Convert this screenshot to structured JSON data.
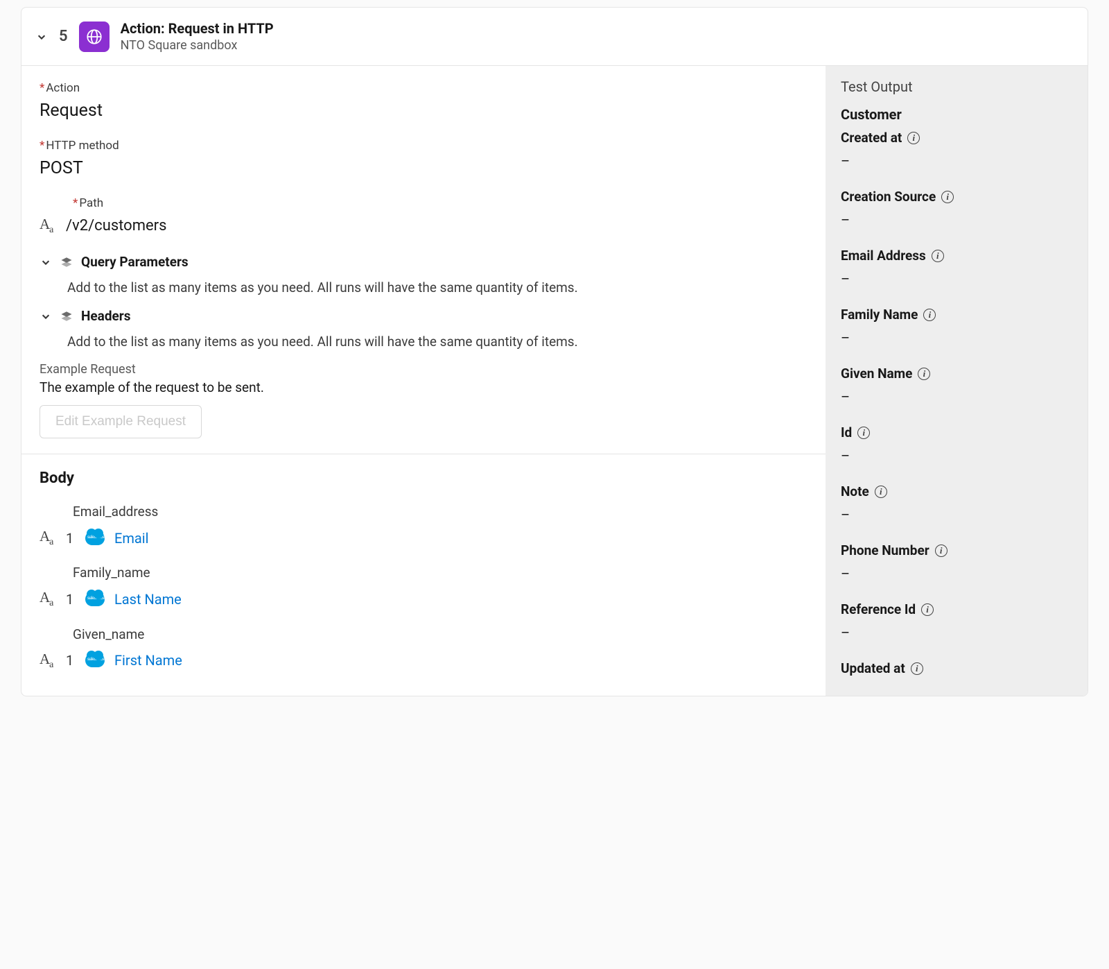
{
  "step": {
    "number": "5",
    "title": "Action: Request in HTTP",
    "subtitle": "NTO Square sandbox"
  },
  "form": {
    "action": {
      "label": "Action",
      "value": "Request"
    },
    "http_method": {
      "label": "HTTP method",
      "value": "POST"
    },
    "path": {
      "label": "Path",
      "value": "/v2/customers"
    },
    "query_params": {
      "title": "Query Parameters",
      "helper": "Add to the list as many items as you need. All runs will have the same quantity of items."
    },
    "headers": {
      "title": "Headers",
      "helper": "Add to the list as many items as you need. All runs will have the same quantity of items."
    },
    "example": {
      "label": "Example Request",
      "desc": "The example of the request to be sent.",
      "button": "Edit Example Request"
    }
  },
  "body": {
    "title": "Body",
    "fields": [
      {
        "label": "Email_address",
        "index": "1",
        "value": "Email"
      },
      {
        "label": "Family_name",
        "index": "1",
        "value": "Last Name"
      },
      {
        "label": "Given_name",
        "index": "1",
        "value": "First Name"
      }
    ]
  },
  "output": {
    "title": "Test Output",
    "section": "Customer",
    "fields": [
      {
        "label": "Created at",
        "value": "–"
      },
      {
        "label": "Creation Source",
        "value": "–"
      },
      {
        "label": "Email Address",
        "value": "–"
      },
      {
        "label": "Family Name",
        "value": "–"
      },
      {
        "label": "Given Name",
        "value": "–"
      },
      {
        "label": "Id",
        "value": "–"
      },
      {
        "label": "Note",
        "value": "–"
      },
      {
        "label": "Phone Number",
        "value": "–"
      },
      {
        "label": "Reference Id",
        "value": "–"
      },
      {
        "label": "Updated at",
        "value": ""
      }
    ]
  }
}
